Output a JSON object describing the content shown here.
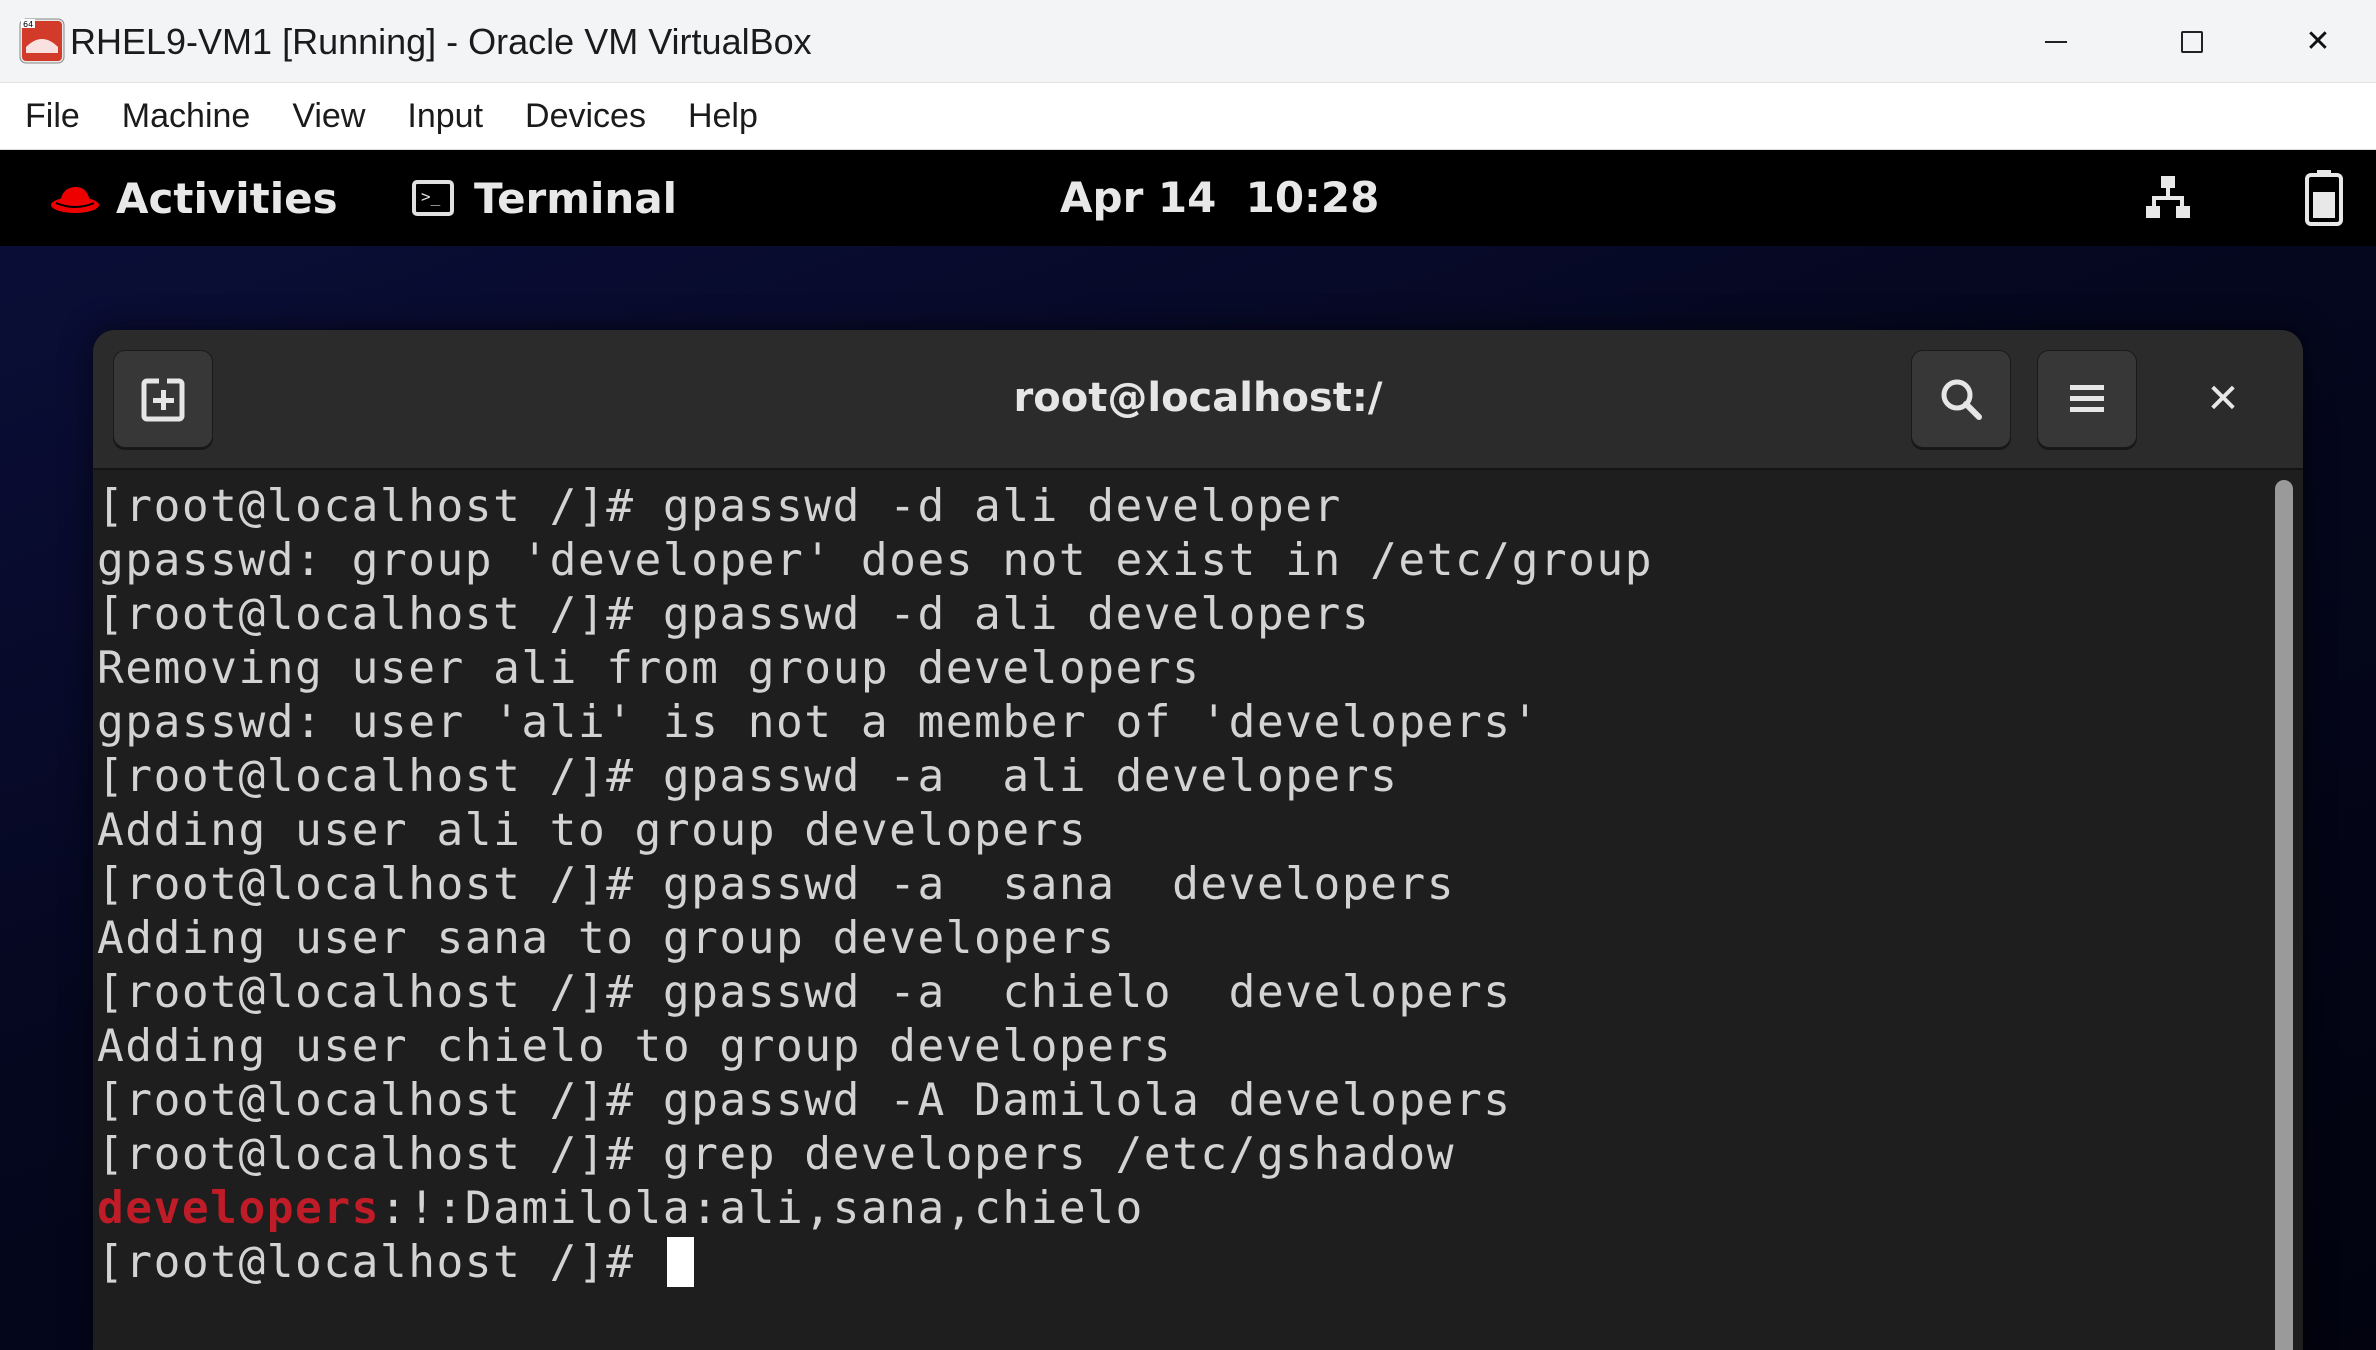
{
  "host_window": {
    "title": "RHEL9-VM1 [Running] - Oracle VM VirtualBox",
    "controls": {
      "minimize": "minimize",
      "maximize": "maximize",
      "close": "✕"
    }
  },
  "menubar": {
    "items": [
      "File",
      "Machine",
      "View",
      "Input",
      "Devices",
      "Help"
    ]
  },
  "gnome_topbar": {
    "activities_label": "Activities",
    "app_menu_label": "Terminal",
    "clock": "Apr 14  10:28",
    "icons": [
      "redhat-logo-icon",
      "terminal-app-icon",
      "network-icon",
      "battery-icon"
    ]
  },
  "terminal": {
    "title": "root@localhost:/",
    "close_glyph": "✕",
    "lines": [
      "[root@localhost /]# gpasswd -d ali developer",
      "gpasswd: group 'developer' does not exist in /etc/group",
      "[root@localhost /]# gpasswd -d ali developers",
      "Removing user ali from group developers",
      "gpasswd: user 'ali' is not a member of 'developers'",
      "[root@localhost /]# gpasswd -a  ali developers",
      "Adding user ali to group developers",
      "[root@localhost /]# gpasswd -a  sana  developers",
      "Adding user sana to group developers",
      "[root@localhost /]# gpasswd -a  chielo  developers",
      "Adding user chielo to group developers",
      "[root@localhost /]# gpasswd -A Damilola developers",
      "[root@localhost /]# grep developers /etc/gshadow"
    ],
    "grep_match": "developers",
    "grep_rest": ":!:Damilola:ali,sana,chielo",
    "prompt": "[root@localhost /]# "
  },
  "colors": {
    "terminal_bg": "#1e1e1e",
    "terminal_fg": "#d3d3d3",
    "match_red": "#c01c28",
    "headerbar": "#2b2b2b",
    "gnome_topbar": "#000000"
  }
}
